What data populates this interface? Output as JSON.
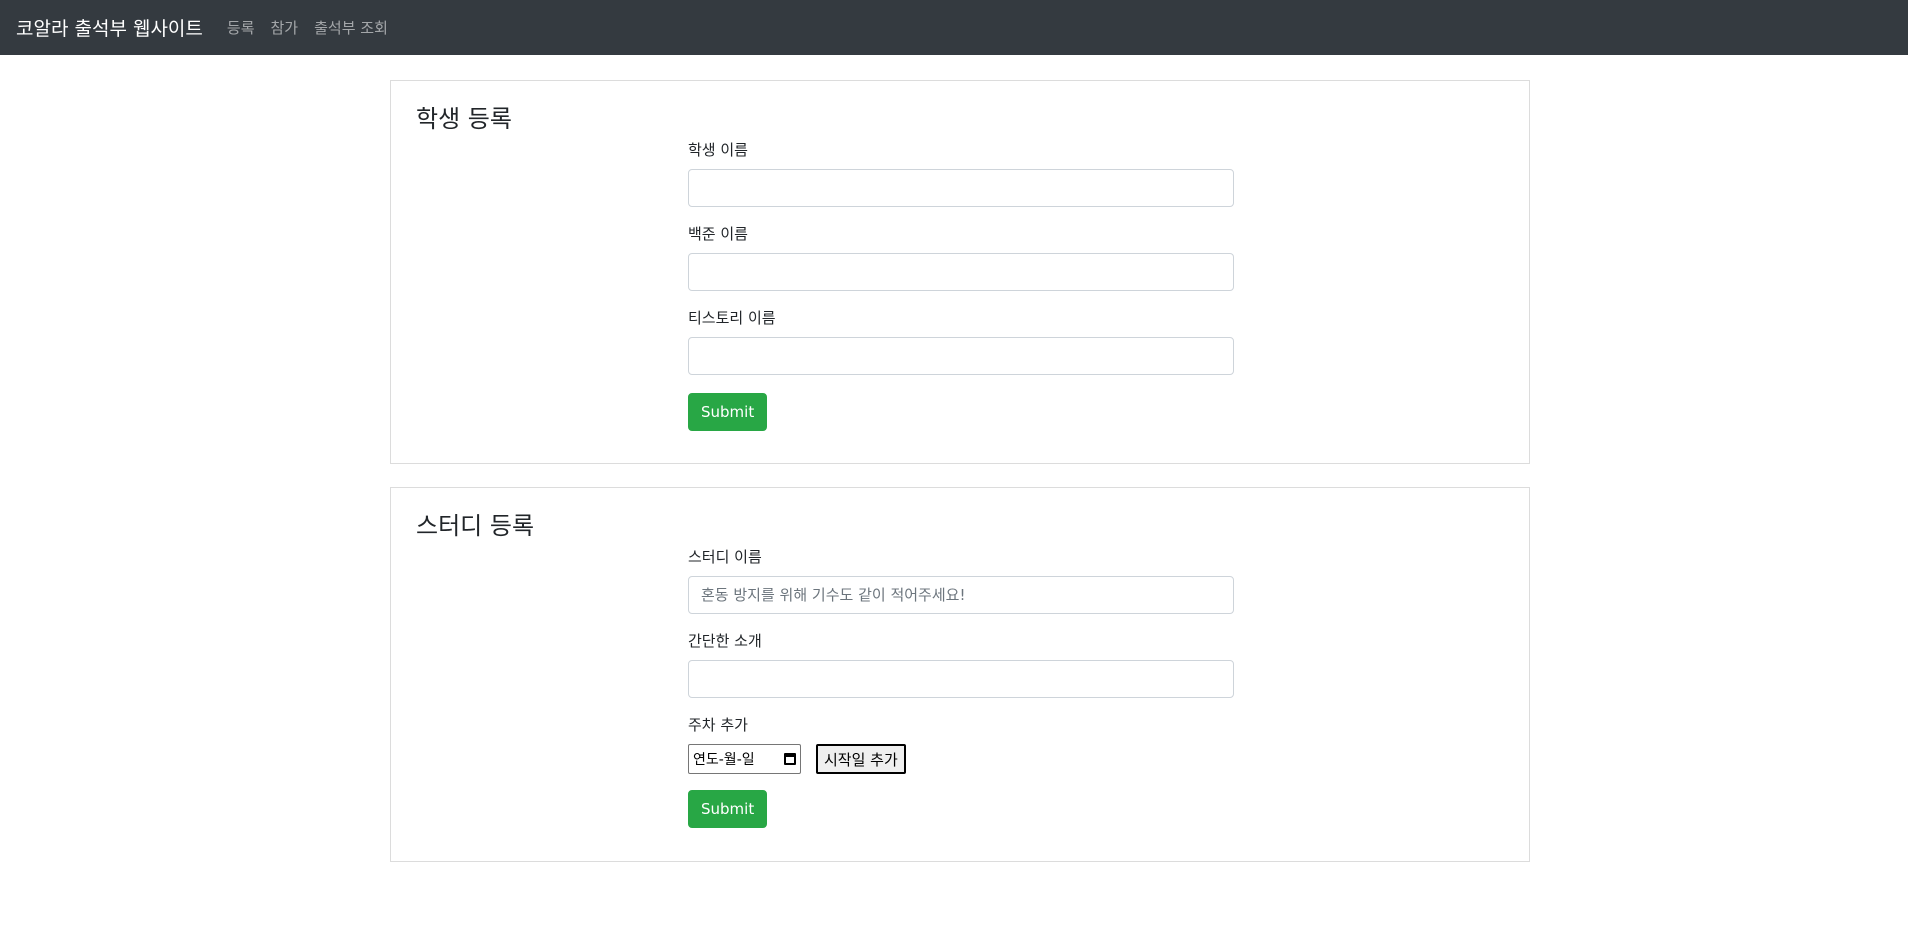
{
  "navbar": {
    "brand": "코알라 출석부 웹사이트",
    "links": [
      "등록",
      "참가",
      "출석부 조회"
    ]
  },
  "student_form": {
    "title": "학생 등록",
    "fields": [
      {
        "label": "학생 이름",
        "value": "",
        "placeholder": ""
      },
      {
        "label": "백준 이름",
        "value": "",
        "placeholder": ""
      },
      {
        "label": "티스토리 이름",
        "value": "",
        "placeholder": ""
      }
    ],
    "submit_label": "Submit"
  },
  "study_form": {
    "title": "스터디 등록",
    "fields": [
      {
        "label": "스터디 이름",
        "value": "",
        "placeholder": "혼동 방지를 위해 기수도 같이 적어주세요!"
      },
      {
        "label": "간단한 소개",
        "value": "",
        "placeholder": ""
      }
    ],
    "week_label": "주차 추가",
    "date_placeholder": "연도-월-일",
    "add_start_label": "시작일 추가",
    "submit_label": "Submit"
  },
  "colors": {
    "navbar_bg": "#343a40",
    "submit_bg": "#28a745"
  },
  "icons": {
    "date_picker": "calendar-icon"
  }
}
